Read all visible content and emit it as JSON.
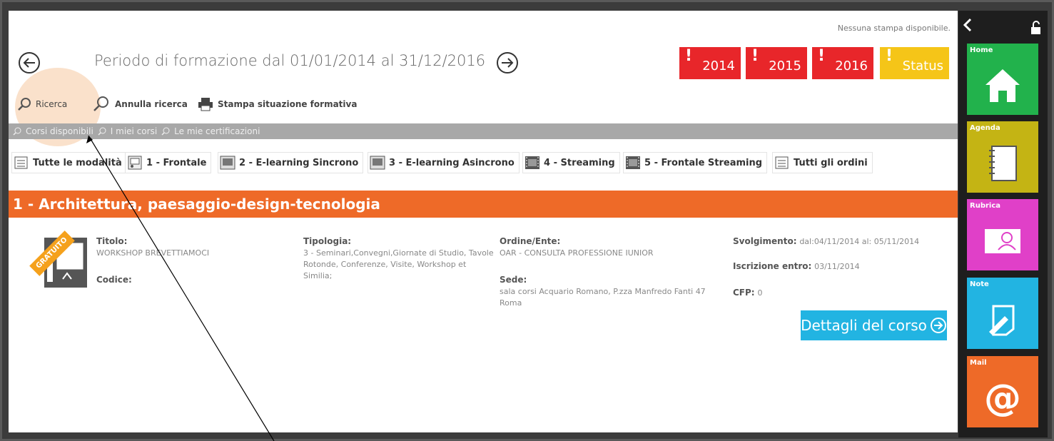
{
  "header": {
    "no_print_msg": "Nessuna stampa disponibile.",
    "period_title": "Periodo di formazione dal 01/01/2014 al 31/12/2016"
  },
  "years": [
    {
      "label": "2014",
      "mark": "!",
      "color": "#e8262a"
    },
    {
      "label": "2015",
      "mark": "!",
      "color": "#e8262a"
    },
    {
      "label": "2016",
      "mark": "!",
      "color": "#e8262a"
    },
    {
      "label": "Status",
      "mark": "!",
      "color": "#f5c518"
    }
  ],
  "toolbar": {
    "search": "Ricerca",
    "cancel_search": "Annulla ricerca",
    "print": "Stampa situazione formativa"
  },
  "subnav": {
    "available": "Corsi disponibili",
    "my_courses": "I miei corsi",
    "my_certs": "Le mie certificazioni"
  },
  "mode_tabs": [
    "Tutte le modalità",
    "1 - Frontale",
    "2 - E-learning Sincrono",
    "3 - E-learning Asincrono",
    "4 - Streaming",
    "5 - Frontale Streaming",
    "Tutti gli ordini"
  ],
  "category": "1 - Architettura, paesaggio-design-tecnologia",
  "course": {
    "badge": "GRATUITO",
    "title_label": "Titolo:",
    "title_value": "WORKSHOP BREVETTIAMOCI",
    "code_label": "Codice:",
    "type_label": "Tipologia:",
    "type_value": "3 - Seminari,Convegni,Giornate di Studio, Tavole Rotonde, Conferenze, Visite, Workshop et Similia;",
    "org_label": "Ordine/Ente:",
    "org_value": "OAR - CONSULTA PROFESSIONE IUNIOR",
    "venue_label": "Sede:",
    "venue_value": "sala corsi Acquario Romano, P.zza Manfredo Fanti 47 Roma",
    "when_label": "Svolgimento:",
    "when_value": "dal:04/11/2014 al: 05/11/2014",
    "enroll_label": "Iscrizione entro:",
    "enroll_value": "03/11/2014",
    "cfp_label": "CFP:",
    "cfp_value": "0",
    "details_button": "Dettagli del corso"
  },
  "sidebar": {
    "tiles": [
      {
        "label": "Home",
        "color": "#22b24c",
        "icon": "home-icon"
      },
      {
        "label": "Agenda",
        "color": "#c4b414",
        "icon": "notebook-icon"
      },
      {
        "label": "Rubrica",
        "color": "#e040c8",
        "icon": "contact-card-icon"
      },
      {
        "label": "Note",
        "color": "#22b4e2",
        "icon": "note-pen-icon"
      },
      {
        "label": "Mail",
        "color": "#ee6a28",
        "icon": "at-icon"
      }
    ]
  }
}
